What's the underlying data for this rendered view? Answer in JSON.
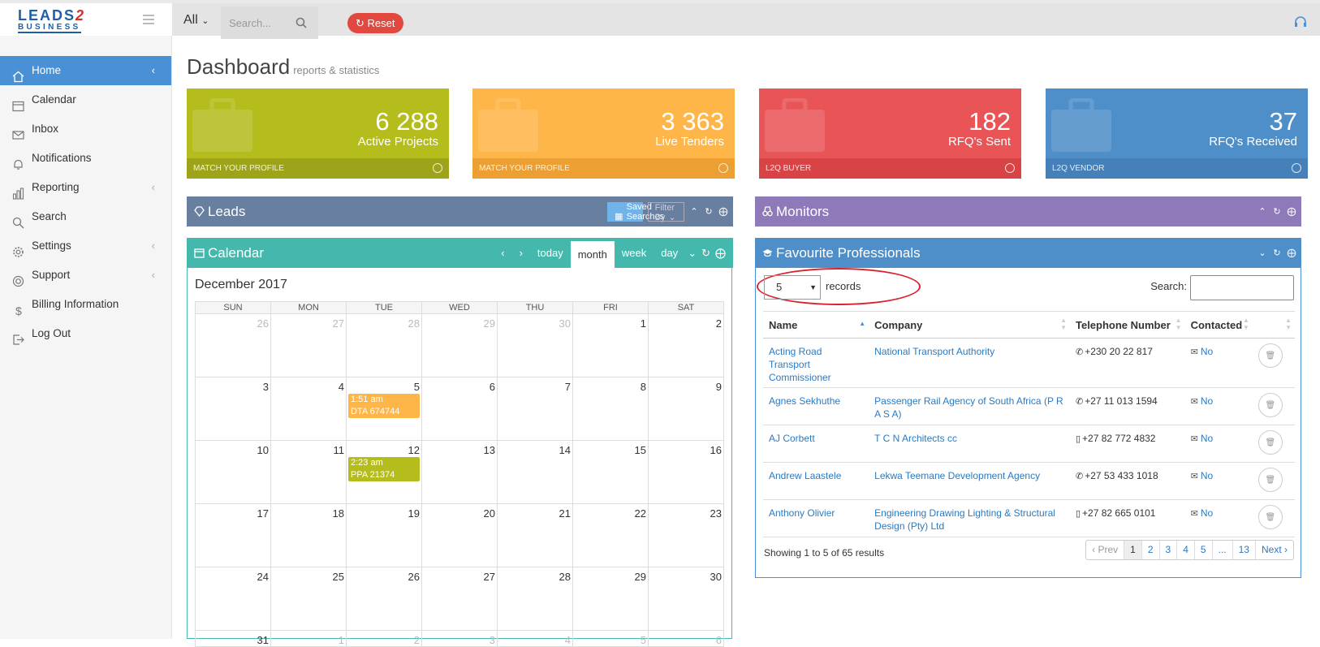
{
  "topbar": {
    "logo_top": "LEADS",
    "logo_accent": "2",
    "logo_bottom": "BUSINESS",
    "scope": "All",
    "search_placeholder": "Search...",
    "reset_label": "Reset"
  },
  "sidebar": {
    "items": [
      {
        "label": "Home",
        "icon": "home-icon",
        "active": true,
        "chevron": true
      },
      {
        "label": "Calendar",
        "icon": "calendar-icon",
        "active": false,
        "chevron": false
      },
      {
        "label": "Inbox",
        "icon": "envelope-icon",
        "active": false,
        "chevron": false
      },
      {
        "label": "Notifications",
        "icon": "bell-icon",
        "active": false,
        "chevron": false
      },
      {
        "label": "Reporting",
        "icon": "bar-chart-icon",
        "active": false,
        "chevron": true
      },
      {
        "label": "Search",
        "icon": "search-icon",
        "active": false,
        "chevron": false
      },
      {
        "label": "Settings",
        "icon": "gear-icon",
        "active": false,
        "chevron": true
      },
      {
        "label": "Support",
        "icon": "lifebuoy-icon",
        "active": false,
        "chevron": true
      },
      {
        "label": "Billing Information",
        "icon": "dollar-icon",
        "active": false,
        "chevron": false
      },
      {
        "label": "Log Out",
        "icon": "logout-icon",
        "active": false,
        "chevron": false
      }
    ]
  },
  "page": {
    "title": "Dashboard",
    "subtitle": "reports & statistics"
  },
  "tiles": [
    {
      "value": "6 288",
      "label": "Active Projects",
      "footer": "MATCH YOUR PROFILE",
      "color": "#b5bd1c",
      "foot_color": "#9ea41a",
      "icon": "briefcase-icon"
    },
    {
      "value": "3 363",
      "label": "Live Tenders",
      "footer": "MATCH YOUR PROFILE",
      "color": "#ffb649",
      "foot_color": "#ec9f33",
      "icon": "tender-icon"
    },
    {
      "value": "182",
      "label": "RFQ's Sent",
      "footer": "L2Q BUYER",
      "color": "#e95457",
      "foot_color": "#d84346",
      "icon": "calculator-icon"
    },
    {
      "value": "37",
      "label": "RFQ's Received",
      "footer": "L2Q VENDOR",
      "color": "#4e8fc9",
      "foot_color": "#4580b8",
      "icon": "book-icon"
    }
  ],
  "leads": {
    "title": "Leads",
    "saved_searches": "Saved Searches",
    "filter_by": "Filter By",
    "color": "#687fa0"
  },
  "monitors": {
    "title": "Monitors",
    "color": "#8e7ab8"
  },
  "calendar": {
    "title": "Calendar",
    "color": "#44b8ac",
    "nav": {
      "prev": "‹",
      "next": "›",
      "today": "today",
      "month": "month",
      "week": "week",
      "day": "day"
    },
    "month_title": "December 2017",
    "weekdays": [
      "SUN",
      "MON",
      "TUE",
      "WED",
      "THU",
      "FRI",
      "SAT"
    ],
    "weeks": [
      [
        {
          "d": "26",
          "o": true
        },
        {
          "d": "27",
          "o": true
        },
        {
          "d": "28",
          "o": true
        },
        {
          "d": "29",
          "o": true
        },
        {
          "d": "30",
          "o": true
        },
        {
          "d": "1"
        },
        {
          "d": "2"
        }
      ],
      [
        {
          "d": "3"
        },
        {
          "d": "4"
        },
        {
          "d": "5",
          "ev": {
            "time": "1:51 am",
            "text": "DTA 674744",
            "color": "#ffb649"
          }
        },
        {
          "d": "6"
        },
        {
          "d": "7"
        },
        {
          "d": "8"
        },
        {
          "d": "9"
        }
      ],
      [
        {
          "d": "10"
        },
        {
          "d": "11"
        },
        {
          "d": "12",
          "ev": {
            "time": "2:23 am",
            "text": "PPA 21374",
            "color": "#b5bd1c"
          }
        },
        {
          "d": "13"
        },
        {
          "d": "14"
        },
        {
          "d": "15"
        },
        {
          "d": "16"
        }
      ],
      [
        {
          "d": "17"
        },
        {
          "d": "18"
        },
        {
          "d": "19"
        },
        {
          "d": "20"
        },
        {
          "d": "21"
        },
        {
          "d": "22"
        },
        {
          "d": "23"
        }
      ],
      [
        {
          "d": "24"
        },
        {
          "d": "25"
        },
        {
          "d": "26"
        },
        {
          "d": "27"
        },
        {
          "d": "28"
        },
        {
          "d": "29"
        },
        {
          "d": "30"
        }
      ],
      [
        {
          "d": "31"
        },
        {
          "d": "1",
          "o": true
        },
        {
          "d": "2",
          "o": true
        },
        {
          "d": "3",
          "o": true
        },
        {
          "d": "4",
          "o": true
        },
        {
          "d": "5",
          "o": true
        },
        {
          "d": "6",
          "o": true
        }
      ]
    ]
  },
  "favourites": {
    "title": "Favourite Professionals",
    "color": "#4e8fc9",
    "records_value": "5",
    "records_label": "records",
    "search_label": "Search:",
    "columns": [
      "Name",
      "Company",
      "Telephone Number",
      "Contacted"
    ],
    "rows": [
      {
        "name": "Acting Road Transport Commissioner",
        "company": "National Transport Authority",
        "phone": "+230 20 22 817",
        "phone_icon": "phone-icon",
        "contacted": "No"
      },
      {
        "name": "Agnes Sekhuthe",
        "company": "Passenger Rail Agency of South Africa (P R A S A)",
        "phone": "+27 11 013 1594",
        "phone_icon": "phone-icon",
        "contacted": "No"
      },
      {
        "name": "AJ Corbett",
        "company": "T C N Architects cc",
        "phone": "+27 82 772 4832",
        "phone_icon": "mobile-icon",
        "contacted": "No"
      },
      {
        "name": "Andrew Laastele",
        "company": "Lekwa Teemane Development Agency",
        "phone": "+27 53 433 1018",
        "phone_icon": "phone-icon",
        "contacted": "No"
      },
      {
        "name": "Anthony Olivier",
        "company": "Engineering Drawing Lighting & Structural Design (Pty) Ltd",
        "phone": "+27 82 665 0101",
        "phone_icon": "mobile-icon",
        "contacted": "No"
      }
    ],
    "showing": "Showing 1 to 5 of 65 results",
    "pager": [
      "‹ Prev",
      "1",
      "2",
      "3",
      "4",
      "5",
      "...",
      "13",
      "Next ›"
    ],
    "current_page": "1"
  }
}
